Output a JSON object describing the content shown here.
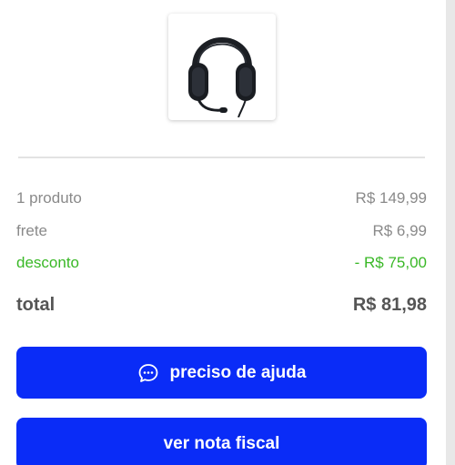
{
  "product": {
    "image_icon": "headphones-image"
  },
  "summary": {
    "items": {
      "label": "1 produto",
      "value": "R$ 149,99"
    },
    "shipping": {
      "label": "frete",
      "value": "R$ 6,99"
    },
    "discount": {
      "label": "desconto",
      "value": "- R$ 75,00",
      "color": "#39b826"
    },
    "total": {
      "label": "total",
      "value": "R$ 81,98"
    }
  },
  "actions": {
    "help_label": "preciso de ajuda",
    "help_icon": "chat-bubble-icon",
    "invoice_label": "ver nota fiscal",
    "button_color": "#0a2cf7"
  }
}
